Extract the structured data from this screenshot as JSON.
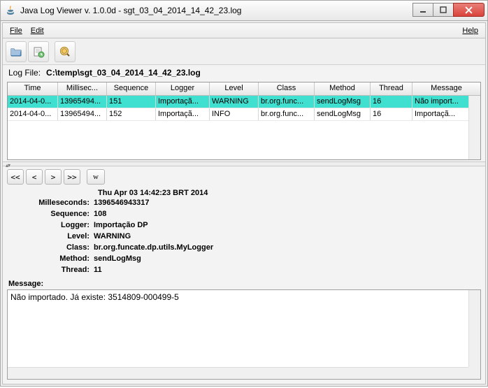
{
  "window": {
    "title": "Java Log Viewer v. 1.0.0d - sgt_03_04_2014_14_42_23.log"
  },
  "menu": {
    "file": "File",
    "edit": "Edit",
    "help": "Help"
  },
  "logfile": {
    "label": "Log File:",
    "path": "C:\\temp\\sgt_03_04_2014_14_42_23.log"
  },
  "columns": {
    "time": "Time",
    "ms": "Millisec...",
    "seq": "Sequence",
    "log": "Logger",
    "lvl": "Level",
    "cls": "Class",
    "meth": "Method",
    "thr": "Thread",
    "msg": "Message"
  },
  "rows": [
    {
      "time": "2014-04-0...",
      "ms": "13965494...",
      "seq": "151",
      "log": "Importaçã...",
      "lvl": "WARNING",
      "cls": "br.org.func...",
      "meth": "sendLogMsg",
      "thr": "16",
      "msg": "Não import..."
    },
    {
      "time": "2014-04-0...",
      "ms": "13965494...",
      "seq": "152",
      "log": "Importaçã...",
      "lvl": "INFO",
      "cls": "br.org.func...",
      "meth": "sendLogMsg",
      "thr": "16",
      "msg": "Importaçã..."
    }
  ],
  "nav": {
    "first": "<<",
    "prev": "<",
    "next": ">",
    "last": ">>",
    "w": "w"
  },
  "detail": {
    "date": "Thu Apr 03 14:42:23 BRT 2014",
    "labels": {
      "ms": "Milleseconds:",
      "seq": "Sequence:",
      "log": "Logger:",
      "lvl": "Level:",
      "cls": "Class:",
      "meth": "Method:",
      "thr": "Thread:"
    },
    "ms": "1396546943317",
    "seq": "108",
    "log": "Importação DP",
    "lvl": "WARNING",
    "cls": "br.org.funcate.dp.utils.MyLogger",
    "meth": "sendLogMsg",
    "thr": "11"
  },
  "message": {
    "label": "Message:",
    "text": "Não importado. Já existe: 3514809-000499-5"
  }
}
